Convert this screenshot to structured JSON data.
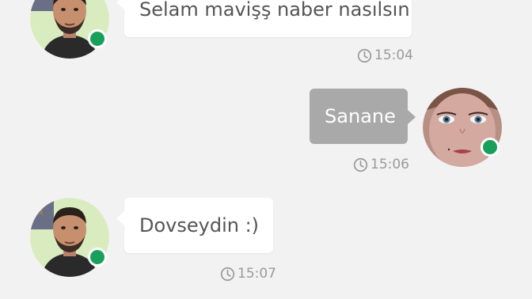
{
  "colors": {
    "background": "#f2f2f2",
    "incoming_bubble": "#ffffff",
    "outgoing_bubble": "#a9a9a9",
    "online_indicator": "#18a05a",
    "timestamp": "#9a9a9a"
  },
  "messages": [
    {
      "direction": "incoming",
      "sender_avatar": "male-avatar",
      "status": "online",
      "text": "Selam mavişş naber nasılsın",
      "time": "15:04",
      "time_icon": "clock-icon"
    },
    {
      "direction": "outgoing",
      "sender_avatar": "female-avatar",
      "status": "online",
      "text": "Sanane",
      "time": "15:06",
      "time_icon": "clock-icon"
    },
    {
      "direction": "incoming",
      "sender_avatar": "male-avatar",
      "status": "online",
      "text": "Dovseydin :)",
      "time": "15:07",
      "time_icon": "clock-icon"
    }
  ]
}
